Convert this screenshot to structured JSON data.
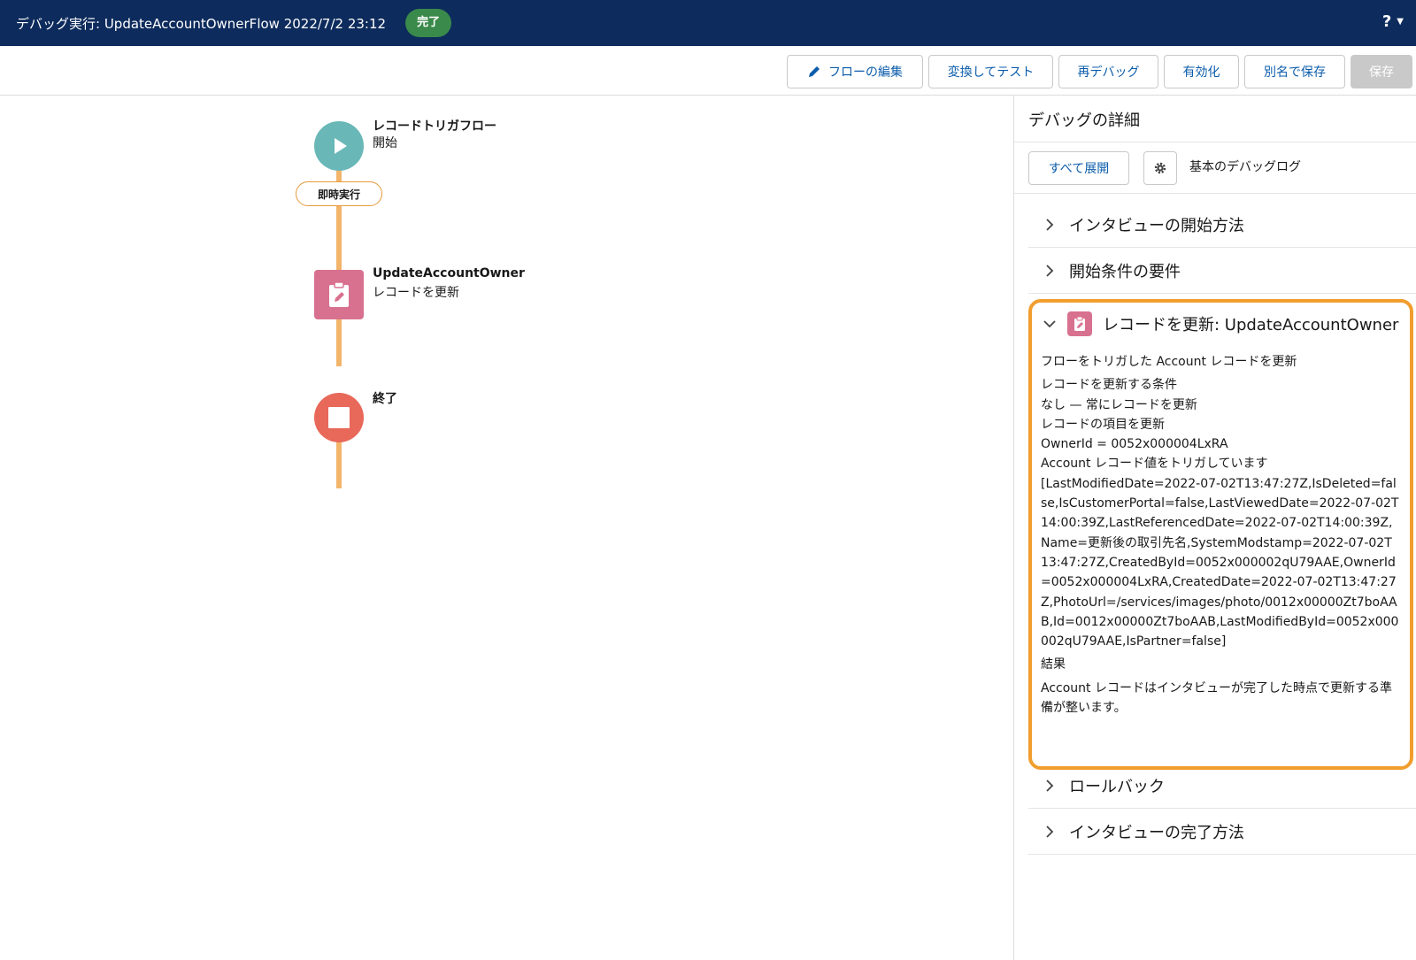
{
  "header": {
    "title": "デバッグ実行: UpdateAccountOwnerFlow 2022/7/2 23:12",
    "status_badge": "完了",
    "help_label": "?"
  },
  "toolbar": {
    "edit_flow": "フローの編集",
    "convert_test": "変換してテスト",
    "rerun_debug": "再デバッグ",
    "activate": "有効化",
    "save_as": "別名で保存",
    "save": "保存"
  },
  "canvas": {
    "start": {
      "title": "レコードトリガフロー",
      "subtitle": "開始"
    },
    "path_label": "即時実行",
    "update": {
      "title": "UpdateAccountOwner",
      "subtitle": "レコードを更新"
    },
    "end": {
      "title": "終了"
    }
  },
  "panel": {
    "title": "デバッグの詳細",
    "expand_all": "すべて展開",
    "log_level": "基本のデバッグログ",
    "sections": {
      "interview_start": "インタビューの開始方法",
      "start_requirements": "開始条件の要件",
      "rollback": "ロールバック",
      "interview_finish": "インタビューの完了方法"
    },
    "detail": {
      "title": "レコードを更新: UpdateAccountOwner",
      "lines": [
        "フローをトリガした Account レコードを更新",
        "レコードを更新する条件",
        "なし — 常にレコードを更新",
        "レコードの項目を更新",
        "OwnerId = 0052x000004LxRA",
        "Account レコード値をトリガしています"
      ],
      "record_values": "[LastModifiedDate=2022-07-02T13:47:27Z,IsDeleted=false,IsCustomerPortal=false,LastViewedDate=2022-07-02T14:00:39Z,LastReferencedDate=2022-07-02T14:00:39Z,Name=更新後の取引先名,SystemModstamp=2022-07-02T13:47:27Z,CreatedById=0052x000002qU79AAE,OwnerId=0052x000004LxRA,CreatedDate=2022-07-02T13:47:27Z,PhotoUrl=/services/images/photo/0012x00000Zt7boAAB,Id=0012x00000Zt7boAAB,LastModifiedById=0052x000002qU79AAE,IsPartner=false]",
      "result_label": "結果",
      "result_text": "Account レコードはインタビューが完了した時点で更新する準備が整います。"
    }
  },
  "colors": {
    "header_bg": "#0d2b5c",
    "badge_green": "#3a8a4b",
    "start_teal": "#6ab7b7",
    "update_pink": "#d8718f",
    "end_red": "#e8685a",
    "connector_orange": "#f2b56b",
    "highlight_orange": "#f19e2e",
    "link_blue": "#0b5cab"
  }
}
